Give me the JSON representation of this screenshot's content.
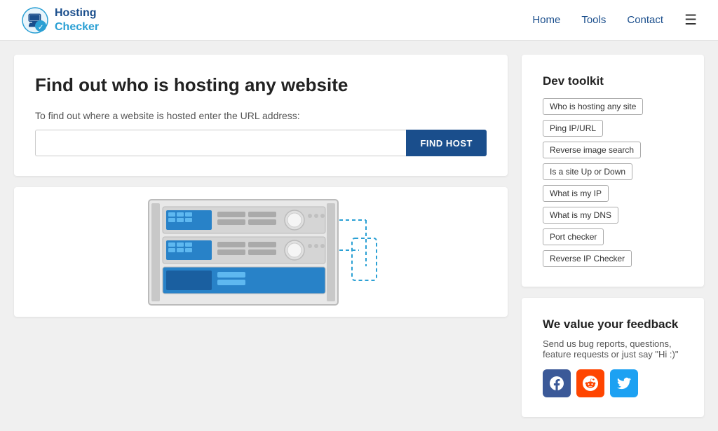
{
  "header": {
    "logo_hosting": "Hosting",
    "logo_checker": "Checker",
    "nav": {
      "home": "Home",
      "tools": "Tools",
      "contact": "Contact"
    }
  },
  "hero": {
    "title": "Find out who is hosting any website",
    "subtitle": "To find out where a website is hosted enter the URL address:",
    "input_placeholder": "",
    "button_label": "FIND HOST"
  },
  "dev_toolkit": {
    "title": "Dev toolkit",
    "tags": [
      "Who is hosting any site",
      "Ping IP/URL",
      "Reverse image search",
      "Is a site Up or Down",
      "What is my IP",
      "What is my DNS",
      "Port checker",
      "Reverse IP Checker"
    ]
  },
  "feedback": {
    "title": "We value your feedback",
    "description": "Send us bug reports, questions, feature requests or just say \"Hi :)\"",
    "social": {
      "facebook": "f",
      "reddit": "r",
      "twitter": "t"
    }
  }
}
